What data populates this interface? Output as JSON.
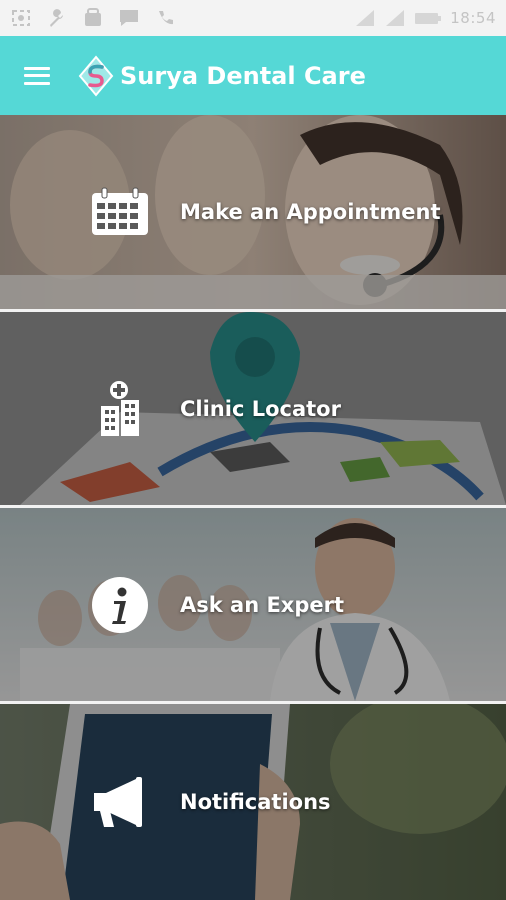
{
  "status_bar": {
    "time": "18:54",
    "icons": [
      "screenshot-icon",
      "wrench-icon",
      "store-icon",
      "message-icon",
      "phone-icon",
      "signal-icon",
      "signal-icon",
      "battery-icon"
    ]
  },
  "app_bar": {
    "title": "Surya Dental Care",
    "menu_icon": "hamburger-menu-icon",
    "logo": "surya-s-logo",
    "color": "#55d8d6"
  },
  "menu": {
    "items": [
      {
        "label": "Make an Appointment",
        "icon": "calendar-icon"
      },
      {
        "label": "Clinic Locator",
        "icon": "hospital-building-icon"
      },
      {
        "label": "Ask an Expert",
        "icon": "info-icon"
      },
      {
        "label": "Notifications",
        "icon": "megaphone-icon"
      }
    ]
  }
}
